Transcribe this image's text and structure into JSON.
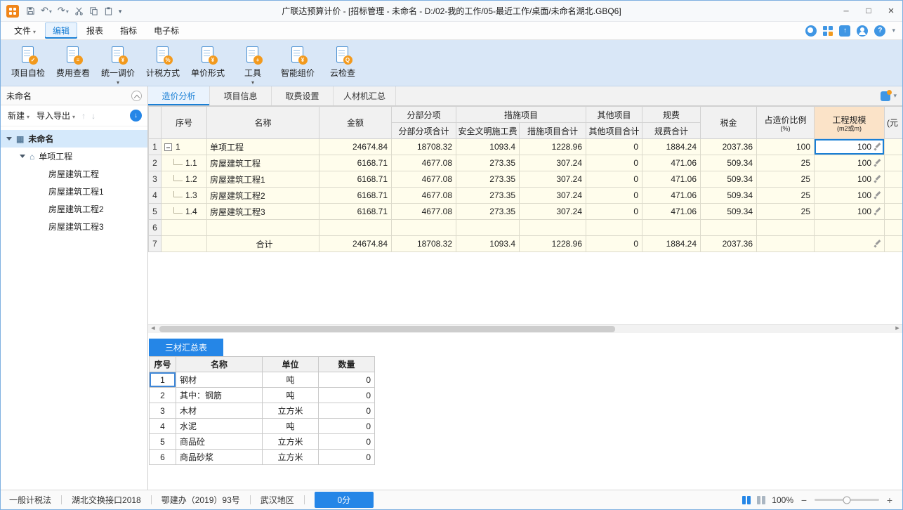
{
  "titlebar": {
    "title": "广联达预算计价 - [招标管理 - 未命名 - D:/02-我的工作/05-最近工作/桌面/未命名湖北.GBQ6]"
  },
  "menubar": {
    "items": [
      {
        "label": "文件"
      },
      {
        "label": "编辑"
      },
      {
        "label": "报表"
      },
      {
        "label": "指标"
      },
      {
        "label": "电子标"
      }
    ]
  },
  "toolbar": {
    "items": [
      {
        "label": "项目自检",
        "icon": "doc-check-icon",
        "glyph": "✓",
        "arrow": false
      },
      {
        "label": "费用查看",
        "icon": "doc-fee-icon",
        "glyph": "≡",
        "arrow": false
      },
      {
        "label": "统一调价",
        "icon": "doc-price-adjust-icon",
        "glyph": "¥",
        "arrow": true
      },
      {
        "label": "计税方式",
        "icon": "doc-tax-icon",
        "glyph": "%",
        "arrow": false
      },
      {
        "label": "单价形式",
        "icon": "doc-unit-price-icon",
        "glyph": "¥",
        "arrow": false
      },
      {
        "label": "工具",
        "icon": "toolbox-icon",
        "glyph": "+",
        "arrow": true
      },
      {
        "label": "智能组价",
        "icon": "smart-pricing-icon",
        "glyph": "¥",
        "arrow": false
      },
      {
        "label": "云检查",
        "icon": "cloud-check-icon",
        "glyph": "Q",
        "arrow": false
      }
    ]
  },
  "sidebar": {
    "title": "未命名",
    "new_label": "新建",
    "import_label": "导入导出",
    "tree": [
      {
        "label": "未命名",
        "level": 0,
        "selected": true,
        "icon": "building",
        "arrow": true
      },
      {
        "label": "单项工程",
        "level": 1,
        "selected": false,
        "icon": "house",
        "arrow": true
      },
      {
        "label": "房屋建筑工程",
        "level": 2,
        "selected": false
      },
      {
        "label": "房屋建筑工程1",
        "level": 2,
        "selected": false
      },
      {
        "label": "房屋建筑工程2",
        "level": 2,
        "selected": false
      },
      {
        "label": "房屋建筑工程3",
        "level": 2,
        "selected": false
      }
    ]
  },
  "tabs": [
    {
      "label": "造价分析",
      "active": true
    },
    {
      "label": "项目信息",
      "active": false
    },
    {
      "label": "取费设置",
      "active": false
    },
    {
      "label": "人材机汇总",
      "active": false
    }
  ],
  "main_table": {
    "headers": {
      "seq": "序号",
      "name": "名称",
      "amount": "金额",
      "fbfx_group": "分部分项",
      "fbfx_total": "分部分项合计",
      "csxm_group": "措施项目",
      "aqwm": "安全文明施工费",
      "csxm_total": "措施项目合计",
      "qtxm_group": "其他项目",
      "qtxm_total": "其他项目合计",
      "gf_group": "规费",
      "gf_total": "规费合计",
      "tax": "税金",
      "ratio_line1": "占造价比例",
      "ratio_line2": "(%)",
      "scale_line1": "工程规模",
      "scale_line2": "(m2或m)",
      "clipped": "(元"
    },
    "rows": [
      {
        "row": "1",
        "seq": "1",
        "kind": "parent",
        "name": "单项工程",
        "amount": "24674.84",
        "fbfx": "18708.32",
        "aqwm": "1093.4",
        "csxm": "1228.96",
        "qtxm": "0",
        "gf": "1884.24",
        "tax": "2037.36",
        "ratio": "100",
        "scale": "100",
        "pencil": true,
        "scale_selected": true
      },
      {
        "row": "2",
        "seq": "1.1",
        "kind": "child",
        "name": "房屋建筑工程",
        "amount": "6168.71",
        "fbfx": "4677.08",
        "aqwm": "273.35",
        "csxm": "307.24",
        "qtxm": "0",
        "gf": "471.06",
        "tax": "509.34",
        "ratio": "25",
        "scale": "100",
        "pencil": true,
        "scale_selected": false
      },
      {
        "row": "3",
        "seq": "1.2",
        "kind": "child",
        "name": "房屋建筑工程1",
        "amount": "6168.71",
        "fbfx": "4677.08",
        "aqwm": "273.35",
        "csxm": "307.24",
        "qtxm": "0",
        "gf": "471.06",
        "tax": "509.34",
        "ratio": "25",
        "scale": "100",
        "pencil": true,
        "scale_selected": false
      },
      {
        "row": "4",
        "seq": "1.3",
        "kind": "child",
        "name": "房屋建筑工程2",
        "amount": "6168.71",
        "fbfx": "4677.08",
        "aqwm": "273.35",
        "csxm": "307.24",
        "qtxm": "0",
        "gf": "471.06",
        "tax": "509.34",
        "ratio": "25",
        "scale": "100",
        "pencil": true,
        "scale_selected": false
      },
      {
        "row": "5",
        "seq": "1.4",
        "kind": "child",
        "name": "房屋建筑工程3",
        "amount": "6168.71",
        "fbfx": "4677.08",
        "aqwm": "273.35",
        "csxm": "307.24",
        "qtxm": "0",
        "gf": "471.06",
        "tax": "509.34",
        "ratio": "25",
        "scale": "100",
        "pencil": true,
        "scale_selected": false
      },
      {
        "row": "6",
        "seq": "",
        "kind": "empty",
        "name": "",
        "amount": "",
        "fbfx": "",
        "aqwm": "",
        "csxm": "",
        "qtxm": "",
        "gf": "",
        "tax": "",
        "ratio": "",
        "scale": "",
        "pencil": false,
        "scale_selected": false
      },
      {
        "row": "7",
        "seq": "",
        "kind": "total",
        "name": "合计",
        "amount": "24674.84",
        "fbfx": "18708.32",
        "aqwm": "1093.4",
        "csxm": "1228.96",
        "qtxm": "0",
        "gf": "1884.24",
        "tax": "2037.36",
        "ratio": "",
        "scale": "",
        "pencil": true,
        "scale_selected": false
      }
    ]
  },
  "bottom_panel": {
    "tab": "三材汇总表",
    "headers": [
      "序号",
      "名称",
      "单位",
      "数量"
    ],
    "rows": [
      [
        "1",
        "钢材",
        "吨",
        "0"
      ],
      [
        "2",
        "其中：钢筋",
        "吨",
        "0"
      ],
      [
        "3",
        "木材",
        "立方米",
        "0"
      ],
      [
        "4",
        "水泥",
        "吨",
        "0"
      ],
      [
        "5",
        "商品砼",
        "立方米",
        "0"
      ],
      [
        "6",
        "商品砂浆",
        "立方米",
        "0"
      ]
    ]
  },
  "statusbar": {
    "items": [
      "一般计税法",
      "湖北交换接口2018",
      "鄂建办（2019）93号",
      "武汉地区"
    ],
    "score": "0分",
    "zoom": "100%"
  }
}
